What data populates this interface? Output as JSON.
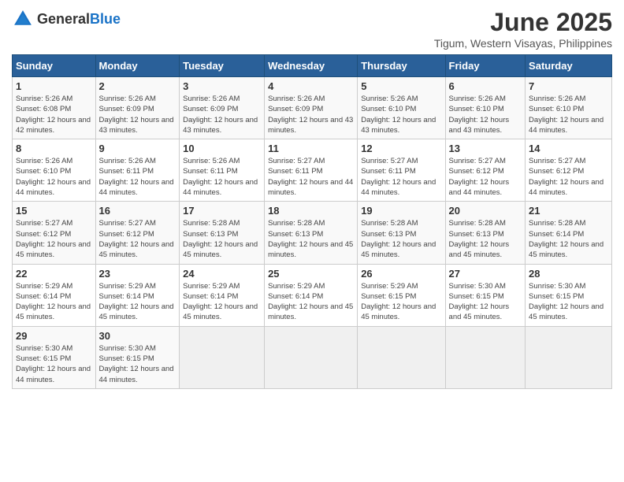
{
  "logo": {
    "general": "General",
    "blue": "Blue"
  },
  "title": "June 2025",
  "subtitle": "Tigum, Western Visayas, Philippines",
  "days_header": [
    "Sunday",
    "Monday",
    "Tuesday",
    "Wednesday",
    "Thursday",
    "Friday",
    "Saturday"
  ],
  "weeks": [
    [
      {
        "day": "1",
        "sunrise": "5:26 AM",
        "sunset": "6:08 PM",
        "daylight": "12 hours and 42 minutes."
      },
      {
        "day": "2",
        "sunrise": "5:26 AM",
        "sunset": "6:09 PM",
        "daylight": "12 hours and 43 minutes."
      },
      {
        "day": "3",
        "sunrise": "5:26 AM",
        "sunset": "6:09 PM",
        "daylight": "12 hours and 43 minutes."
      },
      {
        "day": "4",
        "sunrise": "5:26 AM",
        "sunset": "6:09 PM",
        "daylight": "12 hours and 43 minutes."
      },
      {
        "day": "5",
        "sunrise": "5:26 AM",
        "sunset": "6:10 PM",
        "daylight": "12 hours and 43 minutes."
      },
      {
        "day": "6",
        "sunrise": "5:26 AM",
        "sunset": "6:10 PM",
        "daylight": "12 hours and 43 minutes."
      },
      {
        "day": "7",
        "sunrise": "5:26 AM",
        "sunset": "6:10 PM",
        "daylight": "12 hours and 44 minutes."
      }
    ],
    [
      {
        "day": "8",
        "sunrise": "5:26 AM",
        "sunset": "6:10 PM",
        "daylight": "12 hours and 44 minutes."
      },
      {
        "day": "9",
        "sunrise": "5:26 AM",
        "sunset": "6:11 PM",
        "daylight": "12 hours and 44 minutes."
      },
      {
        "day": "10",
        "sunrise": "5:26 AM",
        "sunset": "6:11 PM",
        "daylight": "12 hours and 44 minutes."
      },
      {
        "day": "11",
        "sunrise": "5:27 AM",
        "sunset": "6:11 PM",
        "daylight": "12 hours and 44 minutes."
      },
      {
        "day": "12",
        "sunrise": "5:27 AM",
        "sunset": "6:11 PM",
        "daylight": "12 hours and 44 minutes."
      },
      {
        "day": "13",
        "sunrise": "5:27 AM",
        "sunset": "6:12 PM",
        "daylight": "12 hours and 44 minutes."
      },
      {
        "day": "14",
        "sunrise": "5:27 AM",
        "sunset": "6:12 PM",
        "daylight": "12 hours and 44 minutes."
      }
    ],
    [
      {
        "day": "15",
        "sunrise": "5:27 AM",
        "sunset": "6:12 PM",
        "daylight": "12 hours and 45 minutes."
      },
      {
        "day": "16",
        "sunrise": "5:27 AM",
        "sunset": "6:12 PM",
        "daylight": "12 hours and 45 minutes."
      },
      {
        "day": "17",
        "sunrise": "5:28 AM",
        "sunset": "6:13 PM",
        "daylight": "12 hours and 45 minutes."
      },
      {
        "day": "18",
        "sunrise": "5:28 AM",
        "sunset": "6:13 PM",
        "daylight": "12 hours and 45 minutes."
      },
      {
        "day": "19",
        "sunrise": "5:28 AM",
        "sunset": "6:13 PM",
        "daylight": "12 hours and 45 minutes."
      },
      {
        "day": "20",
        "sunrise": "5:28 AM",
        "sunset": "6:13 PM",
        "daylight": "12 hours and 45 minutes."
      },
      {
        "day": "21",
        "sunrise": "5:28 AM",
        "sunset": "6:14 PM",
        "daylight": "12 hours and 45 minutes."
      }
    ],
    [
      {
        "day": "22",
        "sunrise": "5:29 AM",
        "sunset": "6:14 PM",
        "daylight": "12 hours and 45 minutes."
      },
      {
        "day": "23",
        "sunrise": "5:29 AM",
        "sunset": "6:14 PM",
        "daylight": "12 hours and 45 minutes."
      },
      {
        "day": "24",
        "sunrise": "5:29 AM",
        "sunset": "6:14 PM",
        "daylight": "12 hours and 45 minutes."
      },
      {
        "day": "25",
        "sunrise": "5:29 AM",
        "sunset": "6:14 PM",
        "daylight": "12 hours and 45 minutes."
      },
      {
        "day": "26",
        "sunrise": "5:29 AM",
        "sunset": "6:15 PM",
        "daylight": "12 hours and 45 minutes."
      },
      {
        "day": "27",
        "sunrise": "5:30 AM",
        "sunset": "6:15 PM",
        "daylight": "12 hours and 45 minutes."
      },
      {
        "day": "28",
        "sunrise": "5:30 AM",
        "sunset": "6:15 PM",
        "daylight": "12 hours and 45 minutes."
      }
    ],
    [
      {
        "day": "29",
        "sunrise": "5:30 AM",
        "sunset": "6:15 PM",
        "daylight": "12 hours and 44 minutes."
      },
      {
        "day": "30",
        "sunrise": "5:30 AM",
        "sunset": "6:15 PM",
        "daylight": "12 hours and 44 minutes."
      },
      null,
      null,
      null,
      null,
      null
    ]
  ],
  "labels": {
    "sunrise": "Sunrise:",
    "sunset": "Sunset:",
    "daylight": "Daylight:"
  }
}
